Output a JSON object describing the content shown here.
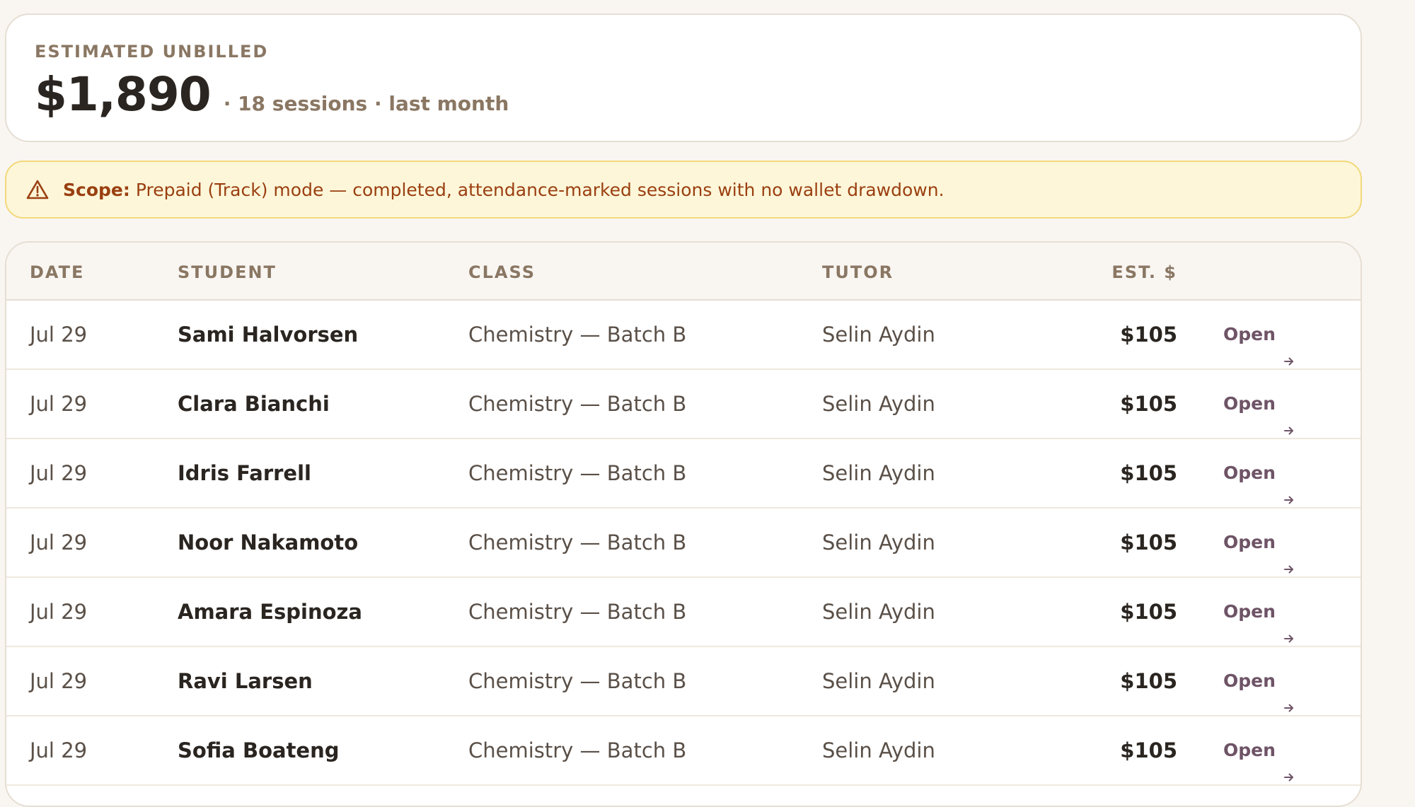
{
  "summary": {
    "label": "ESTIMATED UNBILLED",
    "amount": "$1,890",
    "meta": "· 18 sessions · last month"
  },
  "scope": {
    "label": "Scope:",
    "text": "Prepaid (Track) mode — completed, attendance-marked sessions with no wallet drawdown.",
    "icon": "warning-triangle-icon"
  },
  "table": {
    "headers": {
      "date": "DATE",
      "student": "STUDENT",
      "class": "CLASS",
      "tutor": "TUTOR",
      "amount": "EST. $"
    },
    "open_label": "Open",
    "rows": [
      {
        "date": "Jul 29",
        "student": "Sami Halvorsen",
        "class": "Chemistry — Batch B",
        "tutor": "Selin Aydin",
        "amount": "$105"
      },
      {
        "date": "Jul 29",
        "student": "Clara Bianchi",
        "class": "Chemistry — Batch B",
        "tutor": "Selin Aydin",
        "amount": "$105"
      },
      {
        "date": "Jul 29",
        "student": "Idris Farrell",
        "class": "Chemistry — Batch B",
        "tutor": "Selin Aydin",
        "amount": "$105"
      },
      {
        "date": "Jul 29",
        "student": "Noor Nakamoto",
        "class": "Chemistry — Batch B",
        "tutor": "Selin Aydin",
        "amount": "$105"
      },
      {
        "date": "Jul 29",
        "student": "Amara Espinoza",
        "class": "Chemistry — Batch B",
        "tutor": "Selin Aydin",
        "amount": "$105"
      },
      {
        "date": "Jul 29",
        "student": "Ravi Larsen",
        "class": "Chemistry — Batch B",
        "tutor": "Selin Aydin",
        "amount": "$105"
      },
      {
        "date": "Jul 29",
        "student": "Sofia Boateng",
        "class": "Chemistry — Batch B",
        "tutor": "Selin Aydin",
        "amount": "$105"
      }
    ]
  },
  "colors": {
    "background": "#f9f6f2",
    "accent_link": "#6e5466",
    "warning_text": "#9a3f10",
    "warning_bg": "#fdf6d9",
    "warning_border": "#f2d97a",
    "muted_label": "#8a7763"
  }
}
